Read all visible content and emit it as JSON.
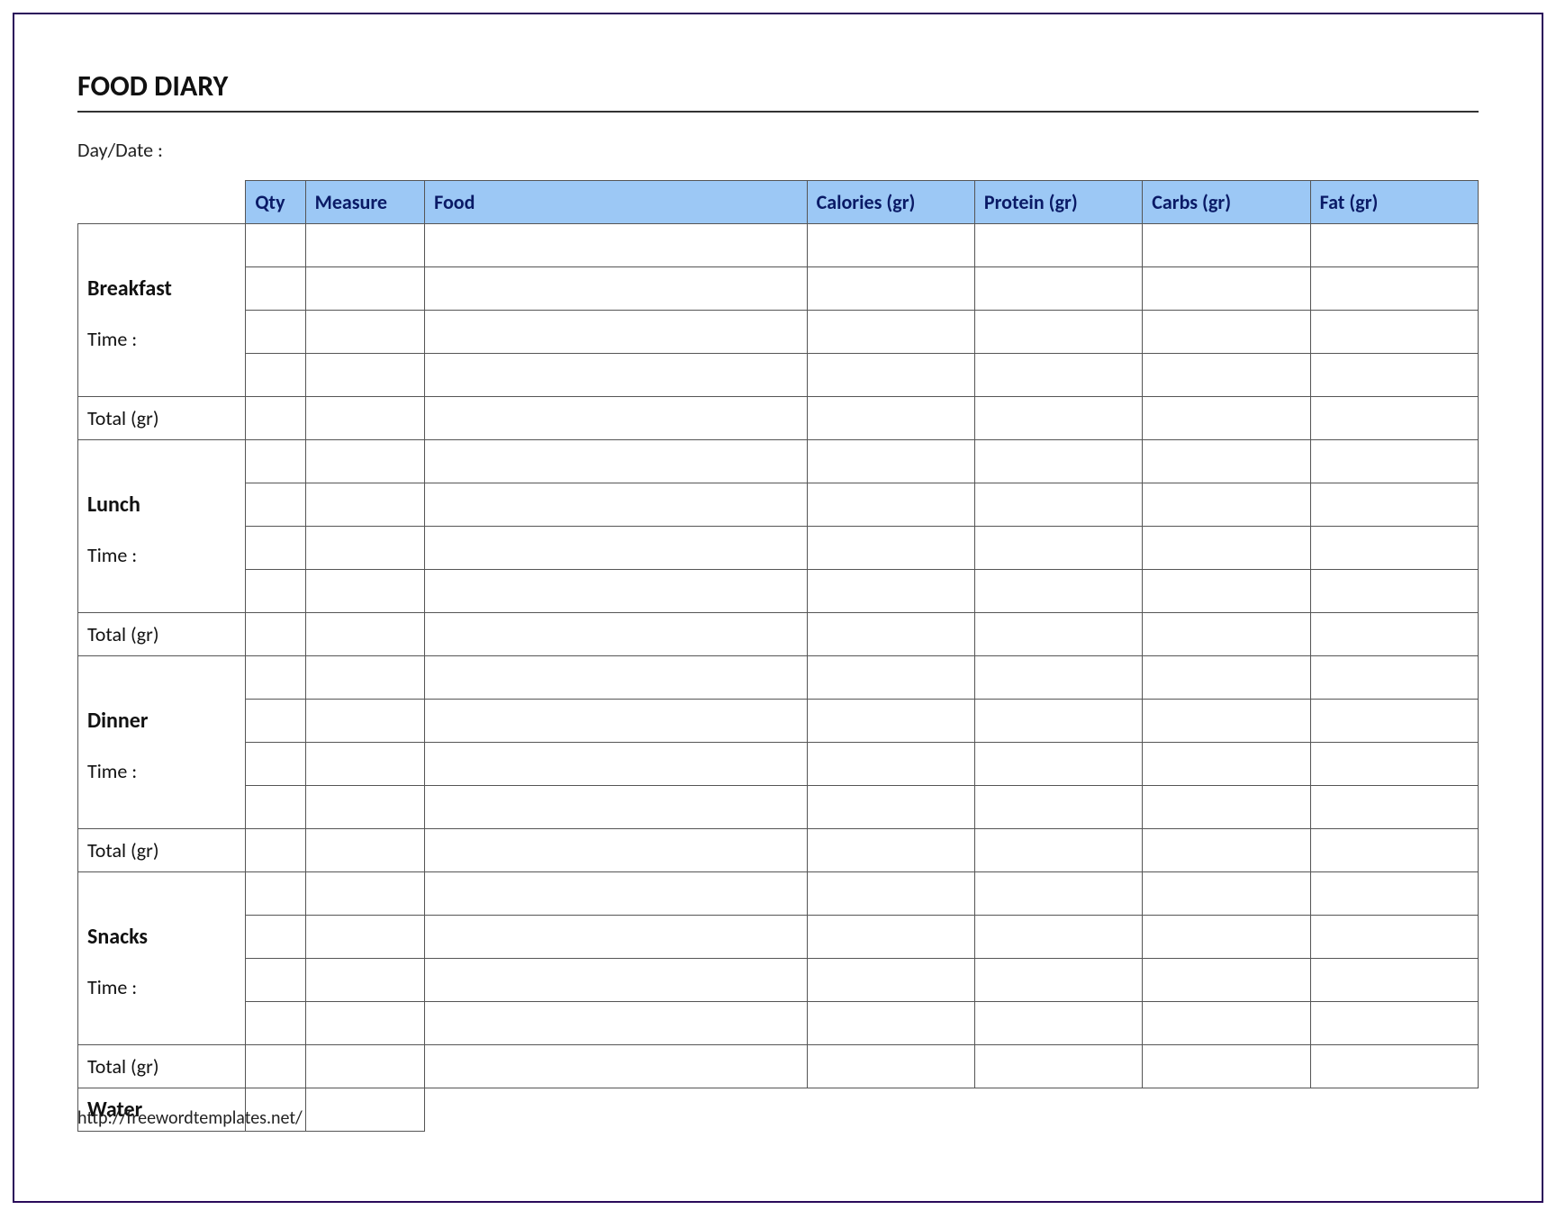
{
  "title": "FOOD DIARY",
  "daydate_label": "Day/Date :",
  "columns": {
    "qty": "Qty",
    "measure": "Measure",
    "food": "Food",
    "calories": "Calories (gr)",
    "protein": "Protein (gr)",
    "carbs": "Carbs (gr)",
    "fat": "Fat (gr)"
  },
  "meals": {
    "breakfast": {
      "name": "Breakfast",
      "time_label": "Time :"
    },
    "lunch": {
      "name": "Lunch",
      "time_label": "Time :"
    },
    "dinner": {
      "name": "Dinner",
      "time_label": "Time :"
    },
    "snacks": {
      "name": "Snacks",
      "time_label": "Time :"
    }
  },
  "total_label": "Total (gr)",
  "water_label": "Water",
  "footer_url": "http://freewordtemplates.net/"
}
